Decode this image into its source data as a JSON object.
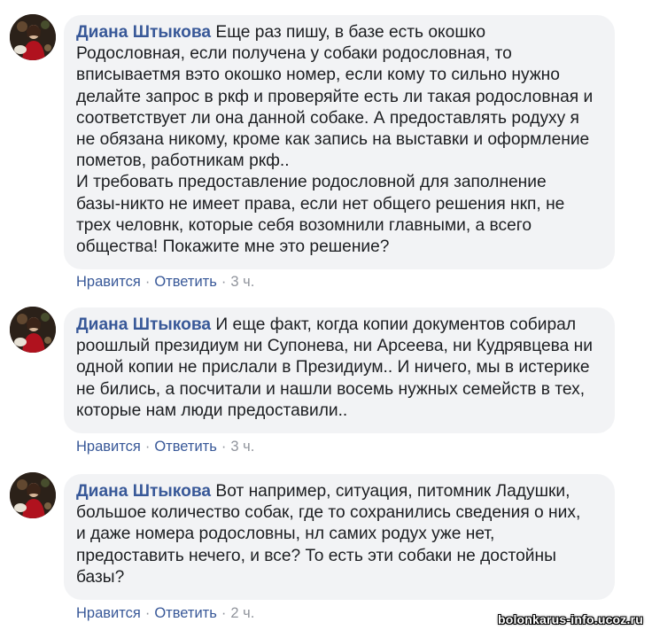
{
  "comments": [
    {
      "author": "Диана Штыкова",
      "text": " Еще раз пишу, в базе есть окошко\nРодословная, если получена у собаки родословная, то\nвписываетмя вэто окошко номер, если кому то сильно нужно\nделайте запрос в ркф и проверяйте есть ли такая родословная и\nсоответствует ли она данной собаке. А предоставлять родуху я\nне обязана никому, кроме как запись на выставки и оформление\nпометов, работникам ркф..\nИ требовать предоставление родословной для заполнение\nбазы-никто не имеет права, если нет общего решения нкп, не\nтрех человнк, которые себя возомнили главными, а всего\nобщества! Покажите мне это решение?",
      "like_label": "Нравится",
      "reply_label": "Ответить",
      "time": "3 ч."
    },
    {
      "author": "Диана Штыкова",
      "text": " И еще факт, когда копии документов собирал\npooшлый президиум ни Супонева, ни Арсеева, ни Кудрявцева ни\nодной копии не прислали в Президиум.. И ничего, мы в истерике\nне бились, а посчитали и нашли восемь нужных семейств в тех,\nкоторые нам люди предоставили..",
      "like_label": "Нравится",
      "reply_label": "Ответить",
      "time": "3 ч."
    },
    {
      "author": "Диана Штыкова",
      "text": " Вот например, ситуация, питомник Ладушки,\nбольшое количество собак, где то сохранились сведения о них,\nи даже номера родословны, нл самих родух уже нет,\nпредоставить нечего, и все? То есть эти собаки не достойны\nбазы?",
      "like_label": "Нравится",
      "reply_label": "Ответить",
      "time": "2 ч."
    }
  ],
  "separator": "·",
  "watermark": "bolonkarus-info.ucoz.ru"
}
